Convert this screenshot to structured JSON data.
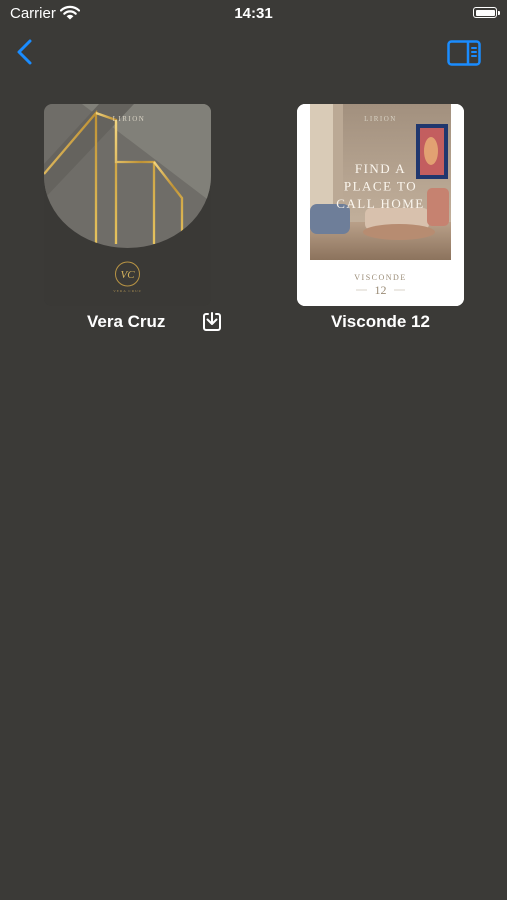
{
  "status_bar": {
    "carrier": "Carrier",
    "time": "14:31"
  },
  "nav": {
    "back_icon": "chevron-left-icon",
    "sidebar_icon": "sidebar-toggle-icon",
    "accent": "#1a8cff"
  },
  "catalogs": [
    {
      "title": "Vera Cruz",
      "cover": {
        "brand": "LIRION",
        "monogram": "VC",
        "caption": "VERA CRUZ"
      },
      "action_icon": "download-icon"
    },
    {
      "title": "Visconde 12",
      "cover": {
        "brand": "LIRION",
        "headline": [
          "FIND A",
          "PLACE TO",
          "CALL HOME"
        ],
        "name": "VISCONDE",
        "number": "12"
      }
    }
  ]
}
